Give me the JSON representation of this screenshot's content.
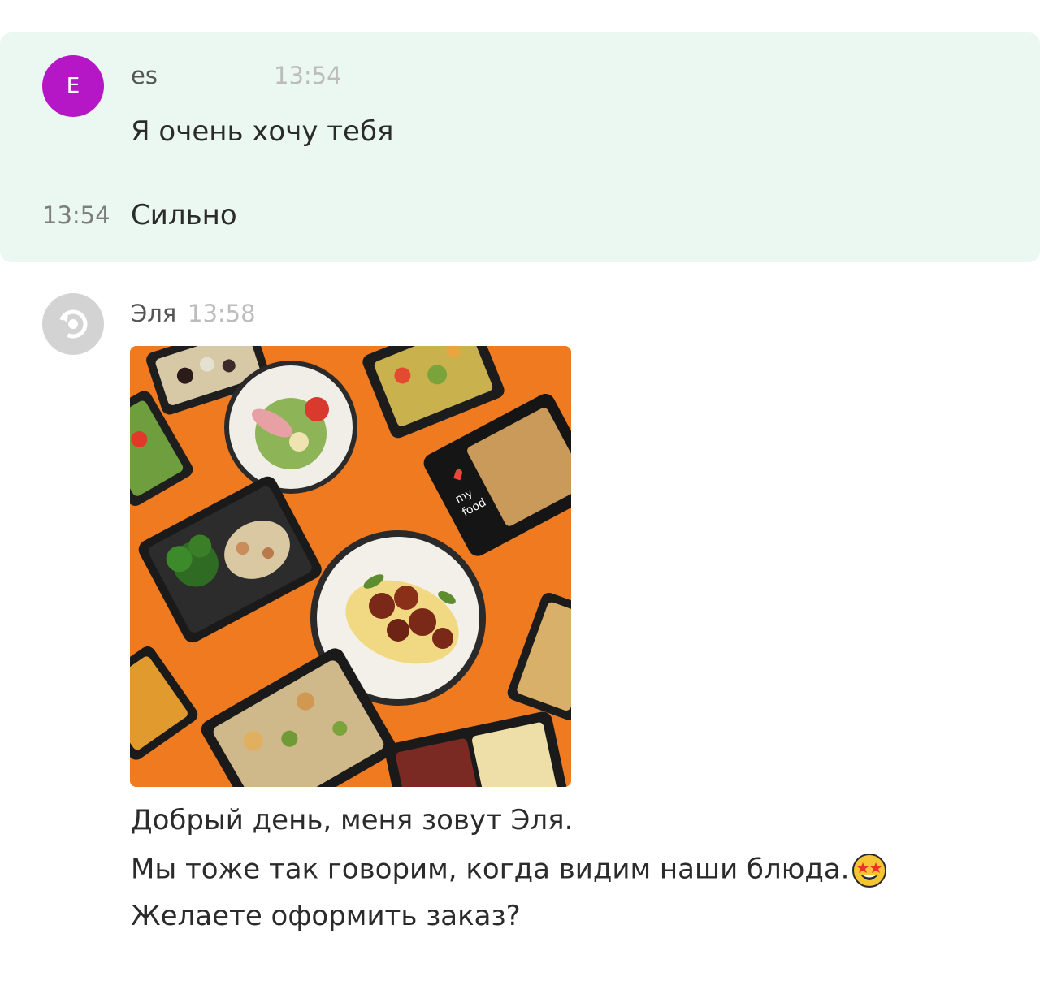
{
  "messages": [
    {
      "sender": "es",
      "avatar_letter": "E",
      "avatar_color": "#b517c6",
      "time": "13:54",
      "lines": [
        "Я очень хочу тебя"
      ]
    },
    {
      "time": "13:54",
      "lines": [
        "Сильно"
      ]
    },
    {
      "sender": "Эля",
      "avatar_icon": "refresh-logo-icon",
      "avatar_color": "#d3d3d3",
      "time": "13:58",
      "image": "food-photo",
      "image_text": [
        "my",
        "food"
      ],
      "lines": [
        "Добрый день, меня зовут Эля.",
        "Мы тоже так говорим, когда видим наши блюда.",
        "Желаете оформить заказ?"
      ],
      "emoji_icon": "star-struck-emoji-icon"
    }
  ],
  "colors": {
    "own_background": "#ebf8f2",
    "photo_background": "#ef7a1f"
  }
}
